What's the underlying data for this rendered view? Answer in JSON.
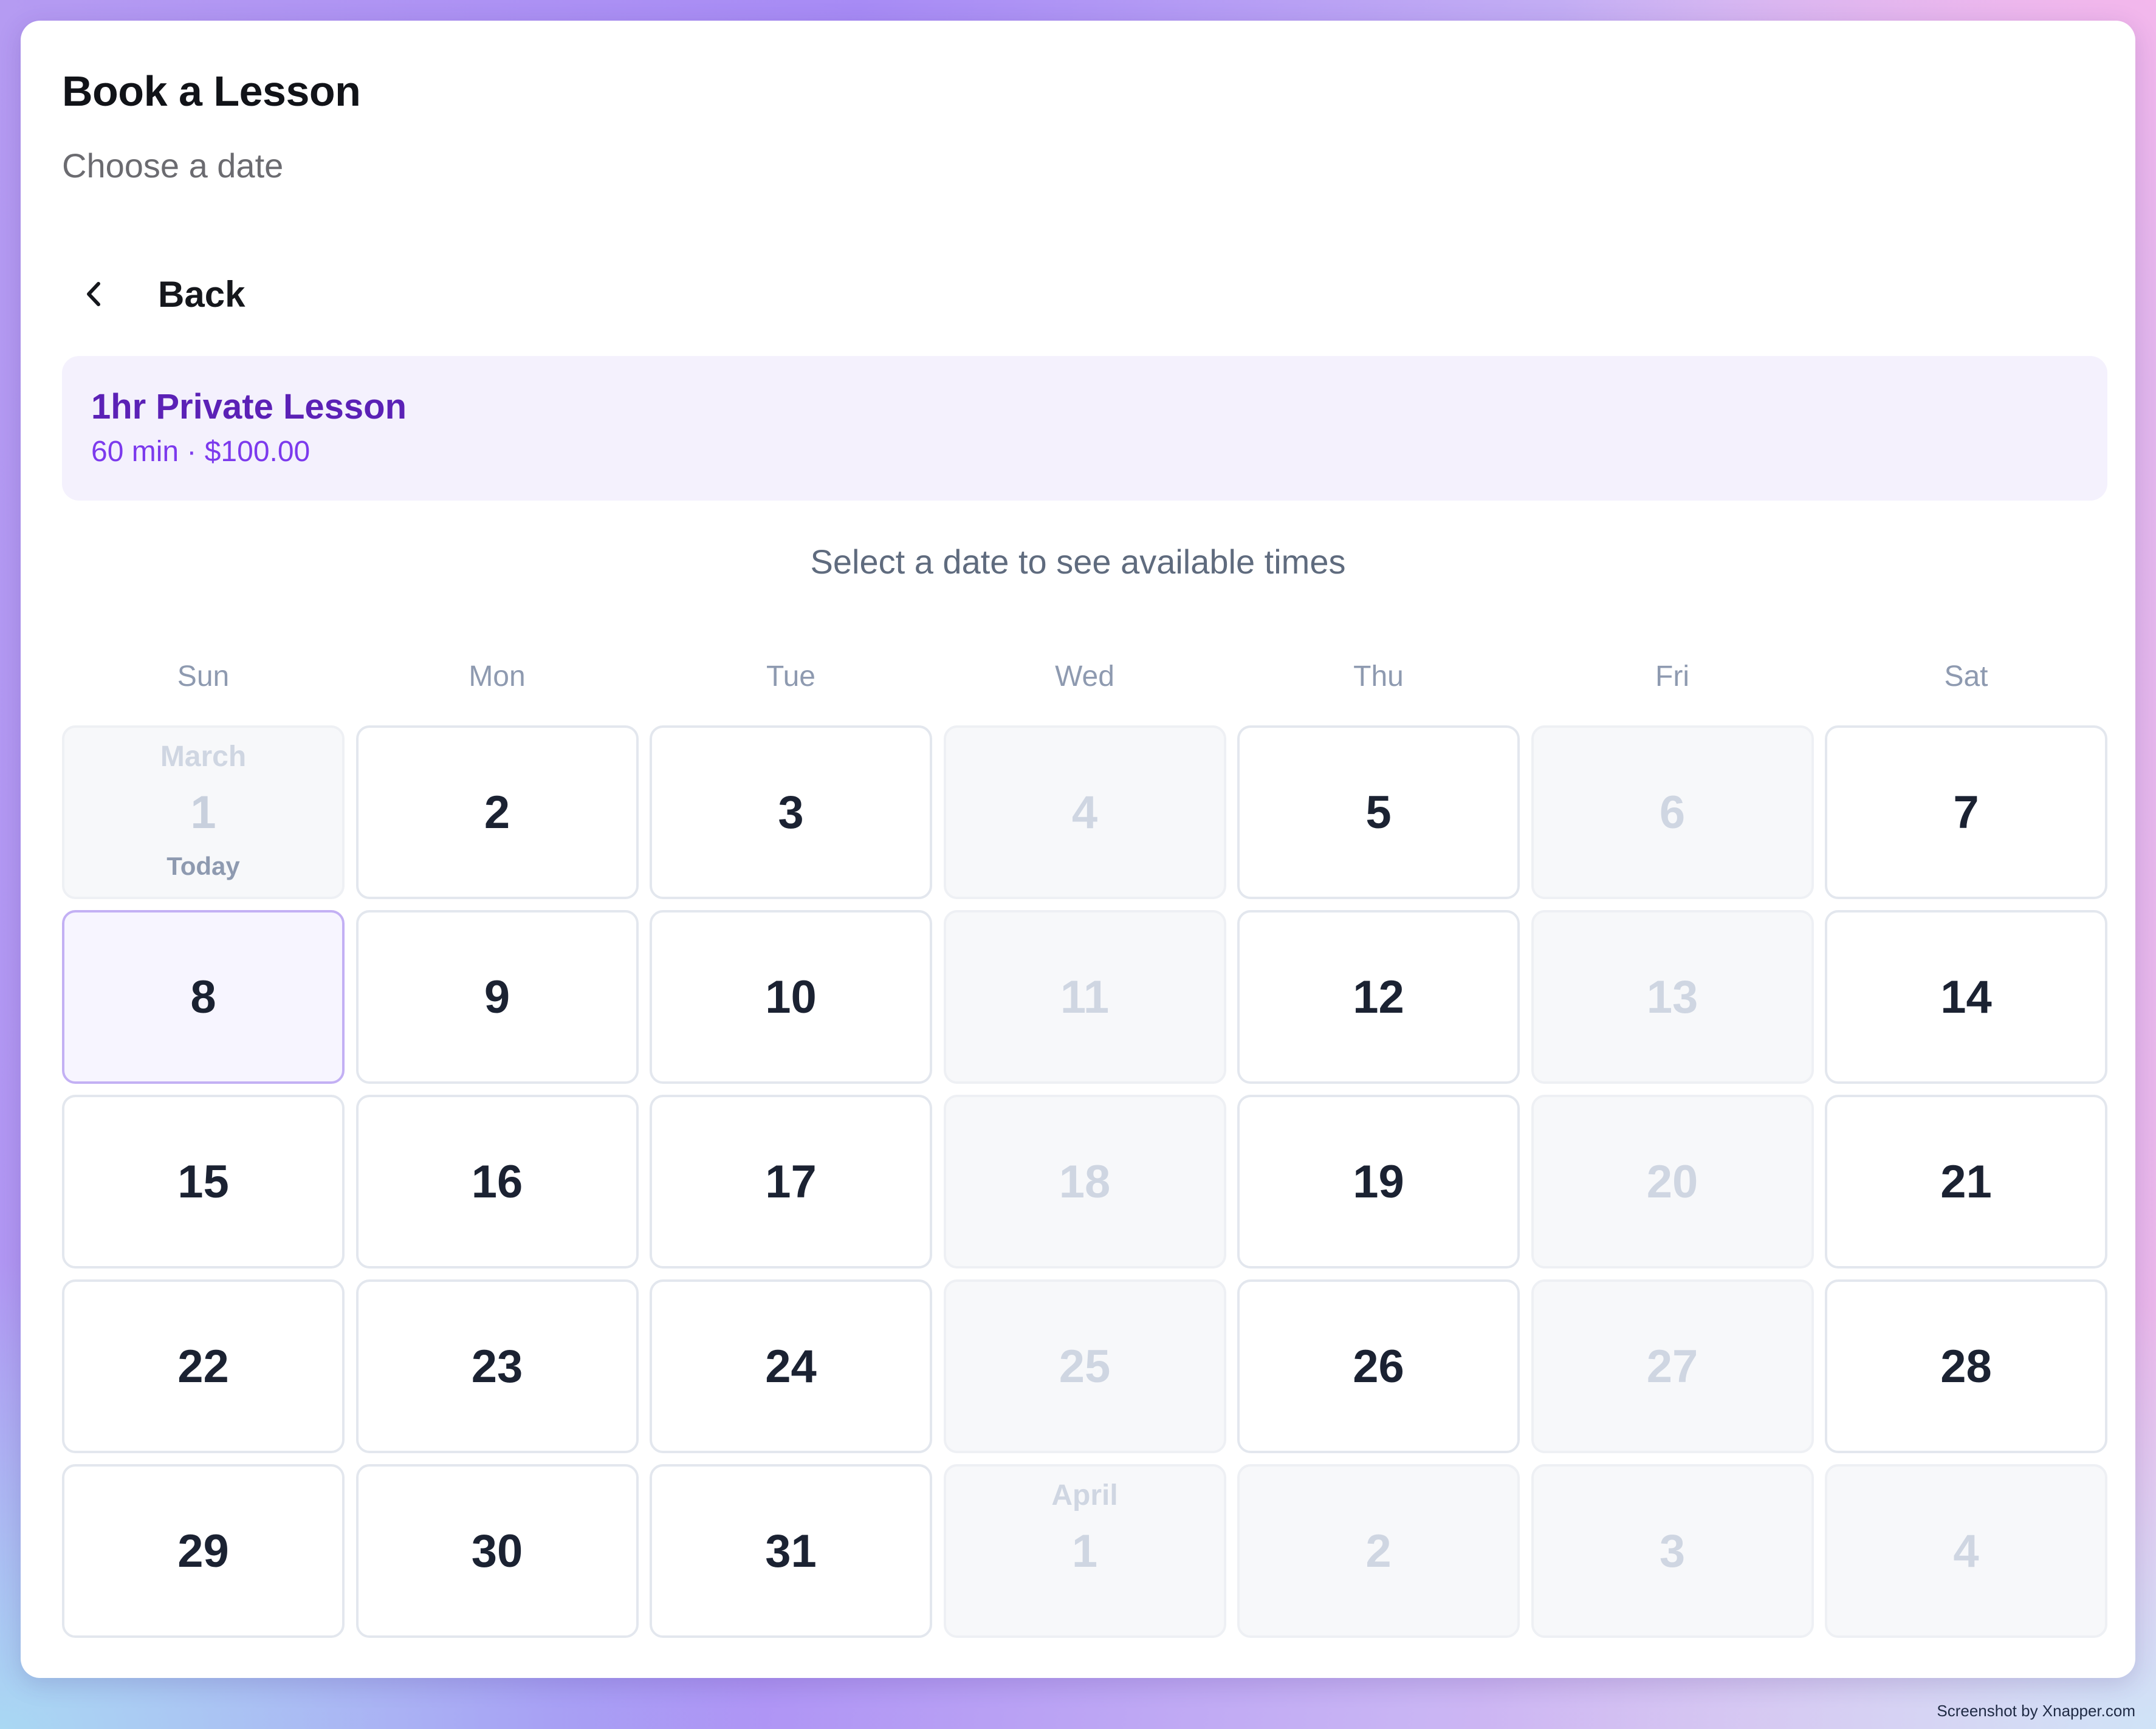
{
  "header": {
    "title": "Book a Lesson",
    "subtitle": "Choose a date"
  },
  "back": {
    "label": "Back",
    "icon": "chevron-left-icon"
  },
  "lesson": {
    "name": "1hr Private Lesson",
    "meta": "60 min · $100.00"
  },
  "hint": "Select a date to see available times",
  "calendar": {
    "weekdays": [
      "Sun",
      "Mon",
      "Tue",
      "Wed",
      "Thu",
      "Fri",
      "Sat"
    ],
    "selected": "8",
    "days": [
      {
        "num": "1",
        "month": "March",
        "today": "Today",
        "disabled": true
      },
      {
        "num": "2",
        "disabled": false
      },
      {
        "num": "3",
        "disabled": false
      },
      {
        "num": "4",
        "disabled": true
      },
      {
        "num": "5",
        "disabled": false
      },
      {
        "num": "6",
        "disabled": true
      },
      {
        "num": "7",
        "disabled": false
      },
      {
        "num": "8",
        "disabled": false,
        "selected": true
      },
      {
        "num": "9",
        "disabled": false
      },
      {
        "num": "10",
        "disabled": false
      },
      {
        "num": "11",
        "disabled": true
      },
      {
        "num": "12",
        "disabled": false
      },
      {
        "num": "13",
        "disabled": true
      },
      {
        "num": "14",
        "disabled": false
      },
      {
        "num": "15",
        "disabled": false
      },
      {
        "num": "16",
        "disabled": false
      },
      {
        "num": "17",
        "disabled": false
      },
      {
        "num": "18",
        "disabled": true
      },
      {
        "num": "19",
        "disabled": false
      },
      {
        "num": "20",
        "disabled": true
      },
      {
        "num": "21",
        "disabled": false
      },
      {
        "num": "22",
        "disabled": false
      },
      {
        "num": "23",
        "disabled": false
      },
      {
        "num": "24",
        "disabled": false
      },
      {
        "num": "25",
        "disabled": true
      },
      {
        "num": "26",
        "disabled": false
      },
      {
        "num": "27",
        "disabled": true
      },
      {
        "num": "28",
        "disabled": false
      },
      {
        "num": "29",
        "disabled": false
      },
      {
        "num": "30",
        "disabled": false
      },
      {
        "num": "31",
        "disabled": false
      },
      {
        "num": "1",
        "month": "April",
        "disabled": true
      },
      {
        "num": "2",
        "disabled": true
      },
      {
        "num": "3",
        "disabled": true
      },
      {
        "num": "4",
        "disabled": true
      }
    ]
  },
  "watermark": "Screenshot by Xnapper.com",
  "colors": {
    "accent": "#5b21b6",
    "accent_light": "#7c3aed",
    "lesson_bg": "#f4f1fd",
    "selected_border": "#c3b0f4"
  }
}
